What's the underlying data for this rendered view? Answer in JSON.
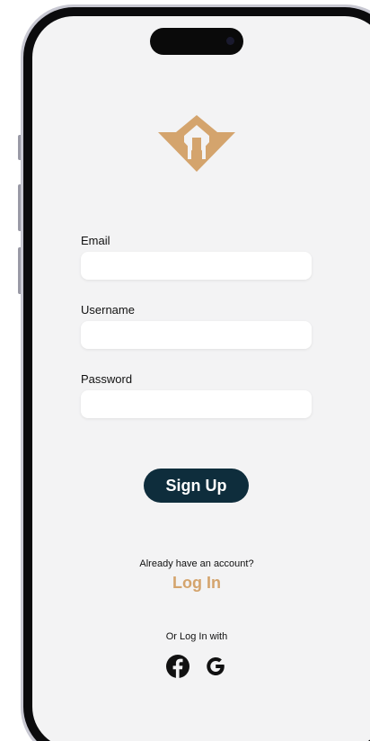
{
  "brand": {
    "accent_color": "#d4a46d",
    "button_color": "#0e2d3c",
    "logo_icon": "house-arrow-logo-icon"
  },
  "form": {
    "email_label": "Email",
    "email_value": "",
    "username_label": "Username",
    "username_value": "",
    "password_label": "Password",
    "password_value": "",
    "submit_label": "Sign Up"
  },
  "login": {
    "prompt": "Already have an account?",
    "link_label": "Log In"
  },
  "social": {
    "prompt": "Or Log In with",
    "providers": [
      {
        "name": "facebook",
        "icon": "facebook-icon"
      },
      {
        "name": "google",
        "icon": "google-icon"
      }
    ]
  }
}
